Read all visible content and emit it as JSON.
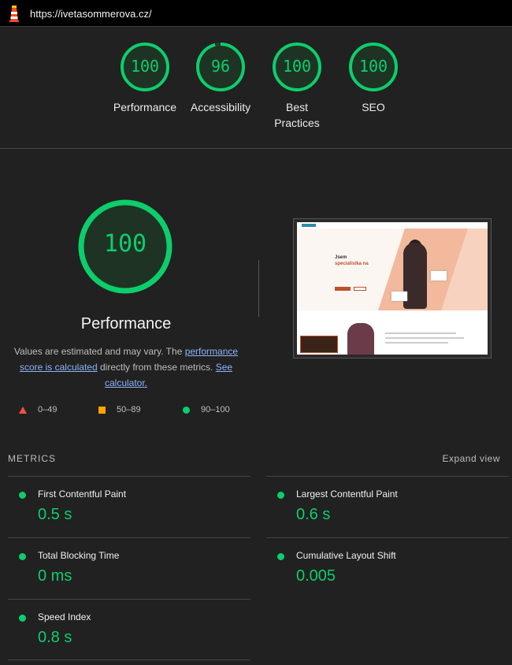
{
  "header": {
    "url": "https://ivetasommerova.cz/",
    "logo_icon": "lighthouse-icon"
  },
  "categories": [
    {
      "label": "Performance",
      "score": 100
    },
    {
      "label": "Accessibility",
      "score": 96
    },
    {
      "label": "Best Practices",
      "score": 100
    },
    {
      "label": "SEO",
      "score": 100
    }
  ],
  "main_gauge": {
    "score": "100",
    "title": "Performance",
    "desc_before": "Values are estimated and may vary. The ",
    "desc_link1": "performance score is calculated",
    "desc_middle": " directly from these metrics. ",
    "desc_link2": "See calculator."
  },
  "legend": {
    "fail": "0–49",
    "average": "50–89",
    "pass": "90–100"
  },
  "screenshot": {
    "hero_title": "Jsem",
    "hero_subtitle": "specialistka na"
  },
  "metrics": {
    "heading": "METRICS",
    "expand_label": "Expand view",
    "items": [
      {
        "name": "First Contentful Paint",
        "value": "0.5 s"
      },
      {
        "name": "Largest Contentful Paint",
        "value": "0.6 s"
      },
      {
        "name": "Total Blocking Time",
        "value": "0 ms"
      },
      {
        "name": "Cumulative Layout Shift",
        "value": "0.005"
      },
      {
        "name": "Speed Index",
        "value": "0.8 s"
      }
    ]
  },
  "colors": {
    "pass": "#0cce6b",
    "average": "#ffa400",
    "fail": "#ff4e42",
    "link": "#8ab4f8",
    "background": "#212121"
  }
}
